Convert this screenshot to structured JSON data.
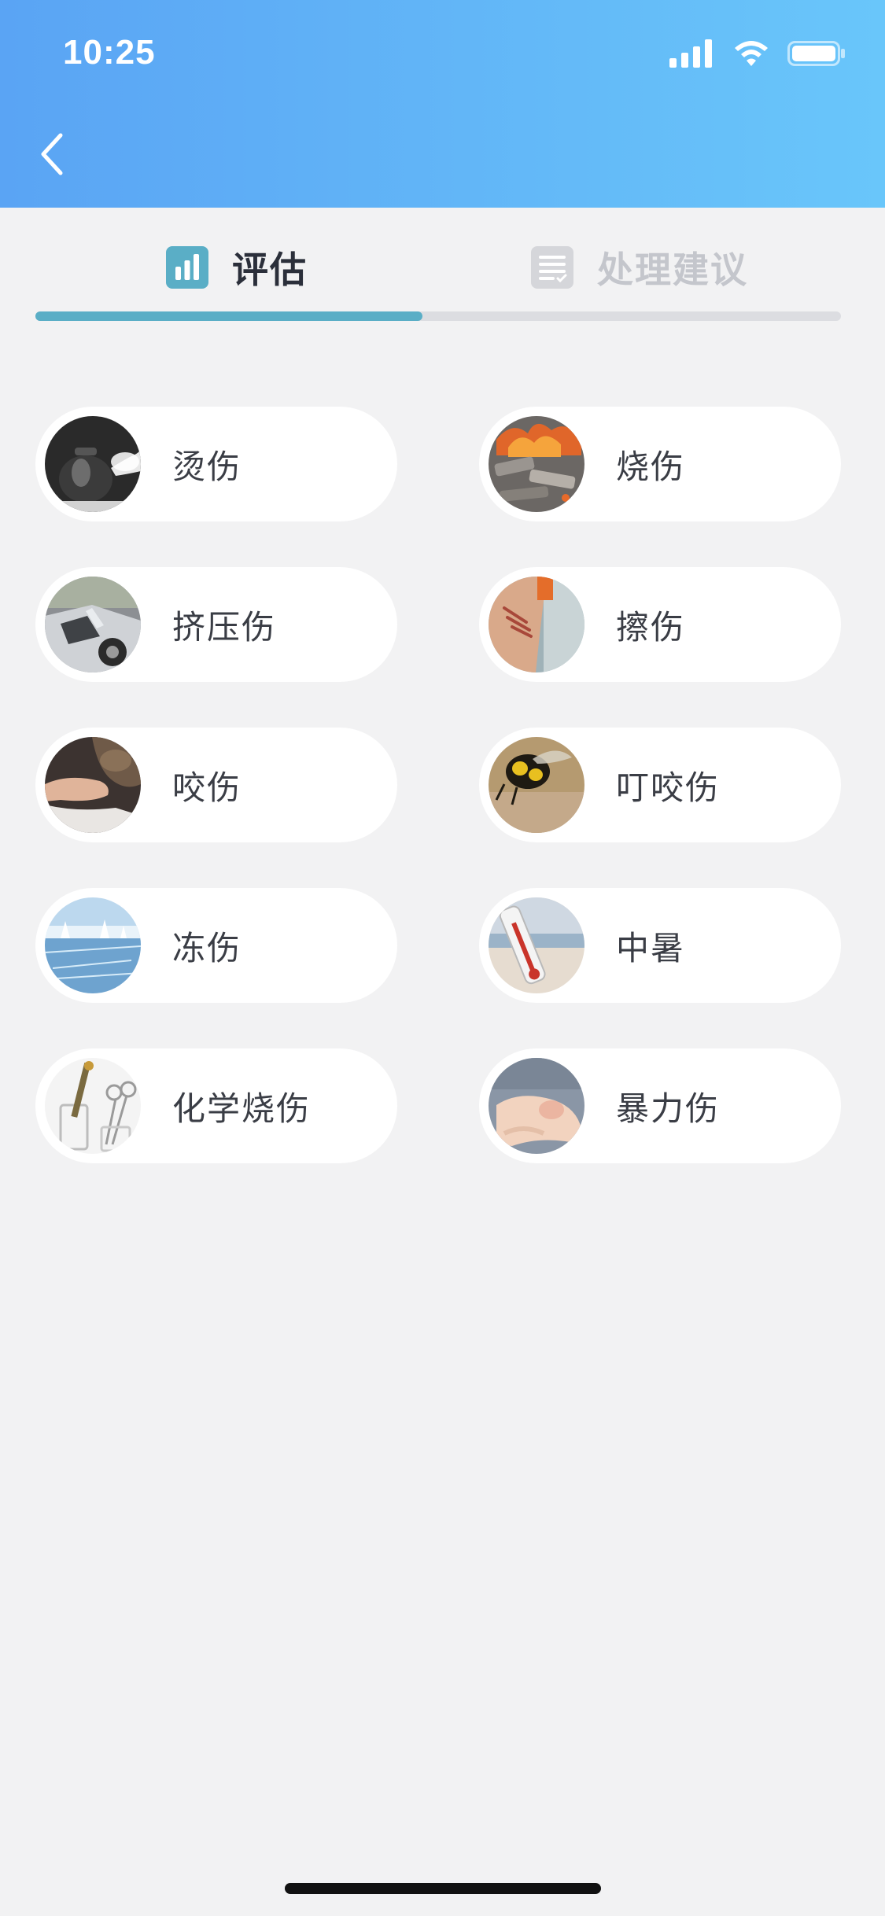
{
  "status_bar": {
    "time": "10:25"
  },
  "tabs": {
    "assess": {
      "label": "评估"
    },
    "advice": {
      "label": "处理建议"
    }
  },
  "items": [
    {
      "label": "烫伤",
      "icon": "kettle-steam-image"
    },
    {
      "label": "烧伤",
      "icon": "burning-embers-image"
    },
    {
      "label": "挤压伤",
      "icon": "car-crash-image"
    },
    {
      "label": "擦伤",
      "icon": "scraped-arm-image"
    },
    {
      "label": "咬伤",
      "icon": "dog-bite-image"
    },
    {
      "label": "叮咬伤",
      "icon": "wasp-sting-image"
    },
    {
      "label": "冻伤",
      "icon": "frozen-lake-image"
    },
    {
      "label": "中暑",
      "icon": "thermometer-beach-image"
    },
    {
      "label": "化学烧伤",
      "icon": "lab-glassware-image"
    },
    {
      "label": "暴力伤",
      "icon": "injured-elbow-image"
    }
  ],
  "colors": {
    "header_start": "#5aa4f4",
    "header_end": "#69c6fa",
    "tab_active_indicator": "#5aaec6",
    "tab_inactive_text": "#c4c6cc",
    "page_background": "#f2f2f3"
  }
}
